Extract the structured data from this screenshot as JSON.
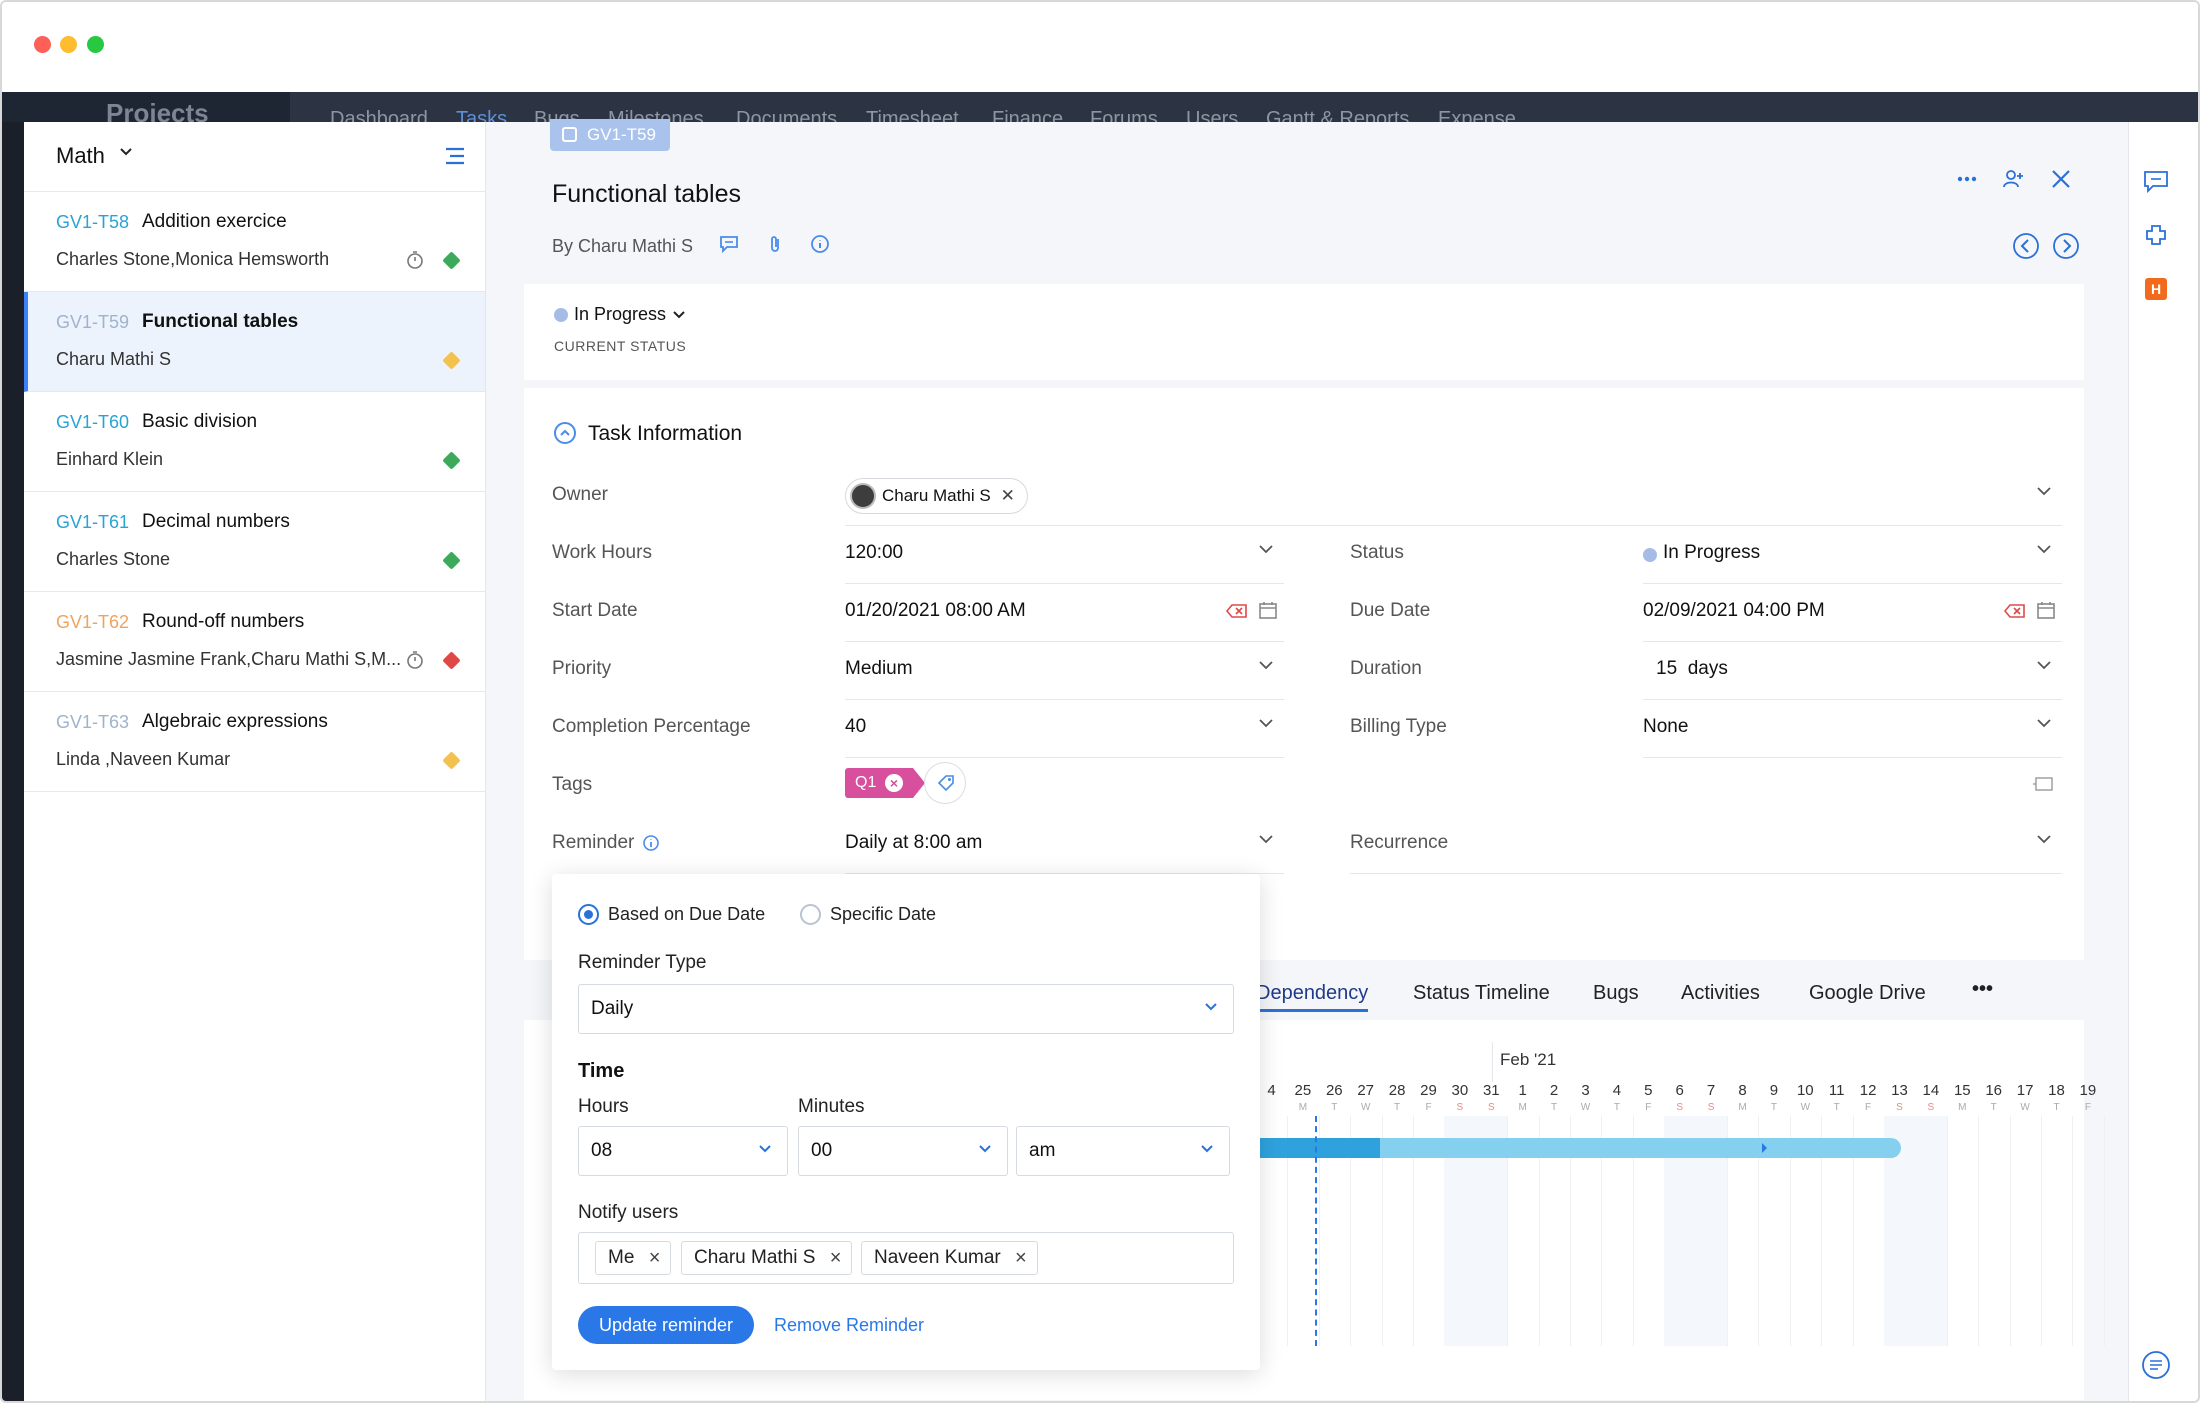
{
  "window": {
    "traffic_lights": [
      "close",
      "minimize",
      "zoom"
    ]
  },
  "appbar": {
    "brand": "Projects",
    "nav": [
      "Dashboard",
      "Tasks",
      "Bugs",
      "Milestones",
      "Documents",
      "Timesheet",
      "Finance",
      "Forums",
      "Users",
      "Gantt & Reports",
      "Expense",
      "..."
    ]
  },
  "sidebar": {
    "title": "Math",
    "tasks": [
      {
        "id": "GV1-T58",
        "name": "Addition exercice",
        "owners": "Charles Stone,Monica Hemsworth",
        "id_color": "#29a3d6",
        "priority_color": "#3caa5a",
        "timer": true,
        "active": false
      },
      {
        "id": "GV1-T59",
        "name": "Functional tables",
        "owners": "Charu Mathi S",
        "id_color": "#9fb3cc",
        "priority_color": "#f2c14e",
        "timer": false,
        "active": true
      },
      {
        "id": "GV1-T60",
        "name": "Basic division",
        "owners": "Einhard Klein",
        "id_color": "#29a3d6",
        "priority_color": "#3caa5a",
        "timer": false,
        "active": false
      },
      {
        "id": "GV1-T61",
        "name": "Decimal numbers",
        "owners": "Charles Stone",
        "id_color": "#29a3d6",
        "priority_color": "#3caa5a",
        "timer": false,
        "active": false
      },
      {
        "id": "GV1-T62",
        "name": "Round-off numbers",
        "owners": "Jasmine Jasmine Frank,Charu Mathi S,M...",
        "id_color": "#f0a35e",
        "priority_color": "#e04848",
        "timer": true,
        "active": false
      },
      {
        "id": "GV1-T63",
        "name": "Algebraic expressions",
        "owners": "Linda ,Naveen Kumar",
        "id_color": "#9fb3cc",
        "priority_color": "#f2c14e",
        "timer": false,
        "active": false
      }
    ]
  },
  "detail": {
    "task_id": "GV1-T59",
    "title": "Functional tables",
    "byline": "By Charu Mathi S",
    "status": "In Progress",
    "status_label": "CURRENT STATUS",
    "section": "Task Information",
    "owner_label": "Owner",
    "owner": "Charu Mathi S",
    "left_fields": [
      {
        "label": "Work Hours",
        "value": "120:00"
      },
      {
        "label": "Start Date",
        "value": "01/20/2021 08:00 AM"
      },
      {
        "label": "Priority",
        "value": "Medium"
      },
      {
        "label": "Completion Percentage",
        "value": "40"
      }
    ],
    "right_fields": [
      {
        "label": "Status",
        "value": "In Progress"
      },
      {
        "label": "Due Date",
        "value": "02/09/2021 04:00 PM"
      },
      {
        "label": "Duration",
        "value": "15  days"
      },
      {
        "label": "Billing Type",
        "value": "None"
      }
    ],
    "tags_label": "Tags",
    "tag": "Q1",
    "reminder_label": "Reminder",
    "reminder_value": "Daily at 8:00 am",
    "recurrence_label": "Recurrence"
  },
  "tabs": [
    "Dependency",
    "Status Timeline",
    "Bugs",
    "Activities",
    "Google Drive",
    "•••"
  ],
  "gantt": {
    "month": "Feb '21",
    "days": [
      "4",
      "25",
      "26",
      "27",
      "28",
      "29",
      "30",
      "31",
      "1",
      "2",
      "3",
      "4",
      "5",
      "6",
      "7",
      "8",
      "9",
      "10",
      "11",
      "12",
      "13",
      "14",
      "15",
      "16",
      "17",
      "18",
      "19"
    ],
    "dows": [
      "",
      "M",
      "T",
      "W",
      "T",
      "F",
      "S",
      "S",
      "M",
      "T",
      "W",
      "T",
      "F",
      "S",
      "S",
      "M",
      "T",
      "W",
      "T",
      "F",
      "S",
      "S",
      "M",
      "T",
      "W",
      "T",
      "F"
    ]
  },
  "reminder_popup": {
    "option_due": "Based on Due Date",
    "option_specific": "Specific Date",
    "type_label": "Reminder Type",
    "type_value": "Daily",
    "time_label": "Time",
    "hours_label": "Hours",
    "hours_value": "08",
    "minutes_label": "Minutes",
    "minutes_value": "00",
    "ampm_value": "am",
    "notify_label": "Notify users",
    "notify_users": [
      "Me",
      "Charu Mathi S",
      "Naveen Kumar"
    ],
    "update_button": "Update reminder",
    "remove_button": "Remove Reminder"
  },
  "colors": {
    "accent": "#2a77e8",
    "tag": "#d8509d",
    "status_dot": "#a5bde6"
  }
}
